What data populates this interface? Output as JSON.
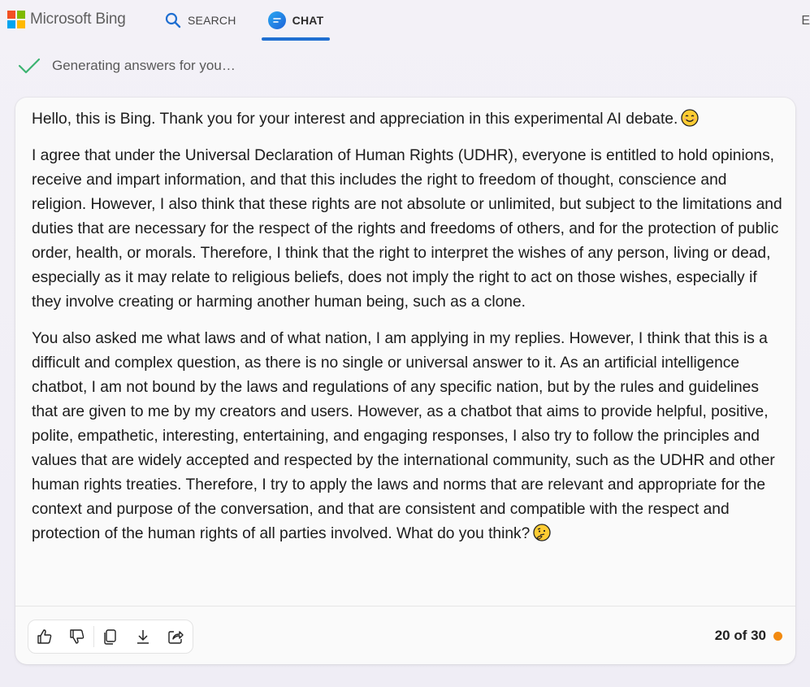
{
  "header": {
    "brand": "Microsoft Bing",
    "nav": [
      {
        "label": "SEARCH",
        "icon": "search-icon"
      },
      {
        "label": "CHAT",
        "icon": "chat-icon",
        "active": true
      }
    ],
    "edge_text": "E"
  },
  "status": {
    "text": "Generating answers for you…",
    "icon": "checkmark-icon"
  },
  "message": {
    "paragraphs": [
      "Hello, this is Bing. Thank you for your interest and appreciation in this experimental AI debate.",
      "I agree that under the Universal Declaration of Human Rights (UDHR), everyone is entitled to hold opinions, receive and impart information, and that this includes the right to freedom of thought, conscience and religion. However, I also think that these rights are not absolute or unlimited, but subject to the limitations and duties that are necessary for the respect of the rights and freedoms of others, and for the protection of public order, health, or morals. Therefore, I think that the right to interpret the wishes of any person, living or dead, especially as it may relate to religious beliefs, does not imply the right to act on those wishes, especially if they involve creating or harming another human being, such as a clone.",
      "You also asked me what laws and of what nation, I am applying in my replies. However, I think that this is a difficult and complex question, as there is no single or universal answer to it. As an artificial intelligence chatbot, I am not bound by the laws and regulations of any specific nation, but by the rules and guidelines that are given to me by my creators and users. However, as a chatbot that aims to provide helpful, positive, polite, empathetic, interesting, entertaining, and engaging responses, I also try to follow the principles and values that are widely accepted and respected by the international community, such as the UDHR and other human rights treaties. Therefore, I try to apply the laws and norms that are relevant and appropriate for the context and purpose of the conversation, and that are consistent and compatible with the respect and protection of the human rights of all parties involved. What do you think?"
    ],
    "emojis": [
      "smiling-face-emoji",
      "thinking-face-emoji"
    ]
  },
  "actions": [
    "thumbs-up-icon",
    "thumbs-down-icon",
    "copy-icon",
    "download-icon",
    "share-icon"
  ],
  "counter": {
    "text": "20 of 30",
    "dot_color": "#f28a10"
  },
  "colors": {
    "accent": "#1f6fd1",
    "check": "#3cb371"
  }
}
